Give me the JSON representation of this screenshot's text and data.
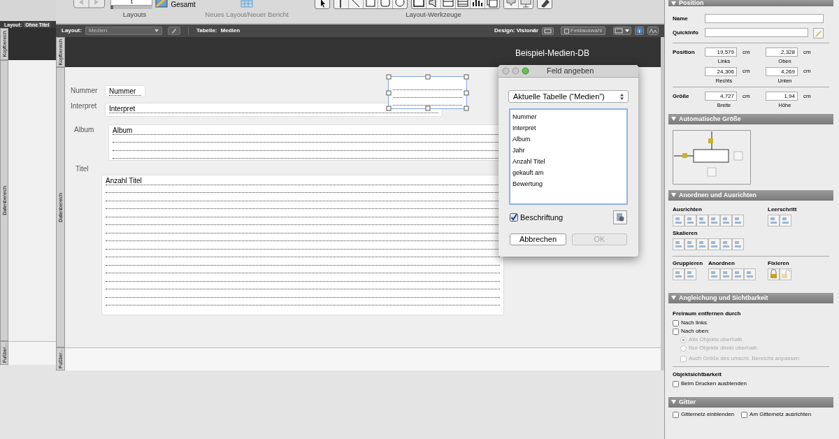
{
  "background_window": {
    "layout_label": "Layout:",
    "layout_name": "Ohne Titel",
    "parts": [
      "Kopfbereich",
      "Datenbereich",
      "Fußber..."
    ]
  },
  "toolbar": {
    "record_value": "1",
    "record_slider": {
      "level": 0
    },
    "view": "Gesamt",
    "groups": [
      {
        "label": "Layouts",
        "disabled": false
      },
      {
        "label": "Neues Layout/Neuer Bericht",
        "disabled": true
      },
      {
        "label": "Layout-Werkzeuge",
        "disabled": false
      }
    ]
  },
  "layout_bar": {
    "layout_label": "Layout:",
    "layout_value": "Medien",
    "table_label": "Tabelle:",
    "table_value": "Medien",
    "design": "Design: Visionär",
    "field_picker": "Feldauswahl"
  },
  "parts": [
    "Kopfbereich",
    "Datenbereich",
    "Fußber..."
  ],
  "layout": {
    "title": "Beispiel-Medien-DB",
    "labels": [
      "Nummer",
      "Interpret",
      "Album",
      "Titel"
    ],
    "fields": [
      {
        "text": "Nummer",
        "selected": false
      },
      {
        "text": "Interpret",
        "selected": false
      },
      {
        "text": "Album",
        "selected": false
      },
      {
        "text": "Anzahl Titel",
        "selected": false
      },
      {
        "selected": true
      }
    ]
  },
  "dialog": {
    "title": "Feld angeben",
    "source": "Aktuelle Tabelle (“Medien”)",
    "fields": [
      "Nummer",
      "Interpret",
      "Album",
      "Jahr",
      "Anzahl Titel",
      "gekauft am",
      "Bewertung"
    ],
    "label_option": {
      "label": "Beschriftung",
      "checked": true
    },
    "buttons": [
      {
        "label": "Abbrechen",
        "disabled": false
      },
      {
        "label": "OK",
        "disabled": true
      }
    ]
  },
  "inspector": {
    "position": {
      "title": "Position",
      "name_label": "Name",
      "tooltip_label": "QuickInfo",
      "position_label": "Position",
      "size_label": "Größe",
      "values": [
        {
          "value": "19,579",
          "unit": "cm",
          "caption": "Links"
        },
        {
          "value": "2,328",
          "unit": "cm",
          "caption": "Oben"
        },
        {
          "value": "24,306",
          "unit": "cm",
          "caption": "Rechts"
        },
        {
          "value": "4,269",
          "unit": "cm",
          "caption": "Unten"
        }
      ],
      "size": [
        {
          "value": "4,727",
          "unit": "cm",
          "caption": "Breite"
        },
        {
          "value": "1,94",
          "unit": "cm",
          "caption": "Höhe"
        }
      ]
    },
    "autosize": {
      "title": "Automatische Größe"
    },
    "arrange": {
      "title": "Anordnen und Ausrichten",
      "align": "Ausrichten",
      "spacing": "Leerschritt",
      "resize": "Skalieren",
      "group": "Gruppieren",
      "order": "Anordnen",
      "lock": "Fixieren"
    },
    "sliding": {
      "title": "Angleichung und Sichtbarkeit",
      "heading": "Freiraum entfernen durch",
      "visibility_heading": "Objektsichtbarkeit",
      "options": [
        {
          "kind": "checkbox",
          "label": "Nach links",
          "checked": false,
          "disabled": false
        },
        {
          "kind": "checkbox",
          "label": "Nach oben:",
          "checked": false,
          "disabled": false
        },
        {
          "kind": "radio",
          "label": "Alle Objekte oberhalb",
          "selected": true,
          "disabled": true
        },
        {
          "kind": "radio",
          "label": "Nur Objekte direkt oberhalb",
          "selected": false,
          "disabled": true
        },
        {
          "kind": "checkbox",
          "label": "Auch Größe des umschl. Bereichs anpassen",
          "checked": false,
          "disabled": true
        }
      ],
      "visibility_options": [
        {
          "kind": "checkbox",
          "label": "Beim Drucken ausblenden",
          "checked": false,
          "disabled": false
        }
      ]
    },
    "grid": {
      "title": "Gitter",
      "options": [
        {
          "kind": "checkbox",
          "label": "Gitternetz einblenden",
          "checked": false,
          "disabled": false
        },
        {
          "kind": "checkbox",
          "label": "Am Gitternetz ausrichten",
          "checked": false,
          "disabled": false
        }
      ]
    }
  }
}
